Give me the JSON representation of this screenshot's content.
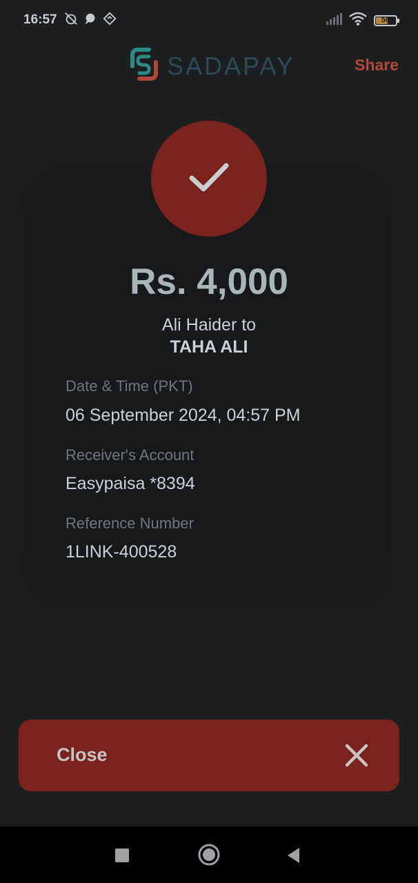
{
  "status_bar": {
    "time": "16:57",
    "battery": "56"
  },
  "header": {
    "brand": "SADAPAY",
    "share_label": "Share"
  },
  "receipt": {
    "amount": "Rs. 4,000",
    "sender": "Ali Haider",
    "connector": "to",
    "receiver": "TAHA ALI",
    "details": [
      {
        "label": "Date & Time (PKT)",
        "value": "06 September 2024, 04:57 PM"
      },
      {
        "label": "Receiver's Account",
        "value": "Easypaisa *8394"
      },
      {
        "label": "Reference Number",
        "value": "1LINK-400528"
      }
    ]
  },
  "footer": {
    "close_label": "Close"
  },
  "colors": {
    "accent": "#7a231e",
    "share": "#b2473b",
    "background": "#1d1e20"
  }
}
